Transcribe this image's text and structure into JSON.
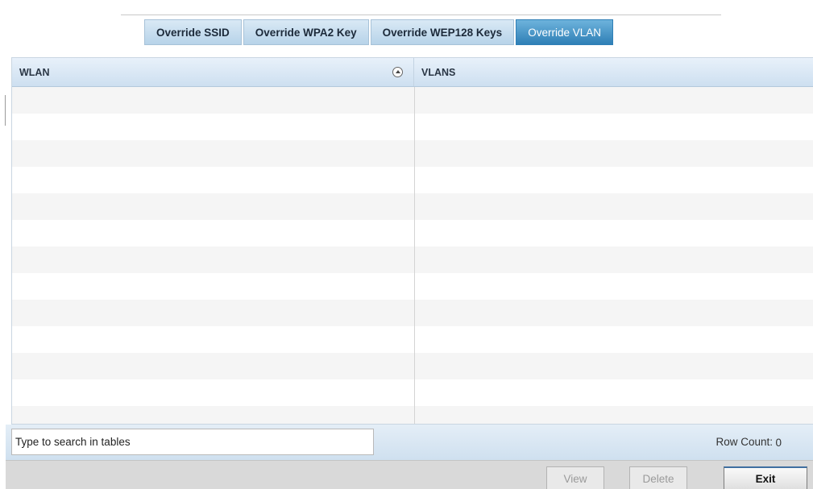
{
  "tabs": [
    {
      "label": "Override SSID"
    },
    {
      "label": "Override WPA2 Key"
    },
    {
      "label": "Override WEP128 Keys"
    },
    {
      "label": "Override VLAN",
      "active": true
    }
  ],
  "table": {
    "columns": [
      {
        "label": "WLAN",
        "sort_icon": "sort-ascending-icon"
      },
      {
        "label": "VLANS"
      }
    ],
    "rows": []
  },
  "search": {
    "placeholder": "Type to search in tables"
  },
  "row_count": {
    "label": "Row Count:",
    "value": "0"
  },
  "buttons": {
    "view": "View",
    "delete": "Delete",
    "exit": "Exit"
  },
  "colors": {
    "active_tab": "#2f7fb6",
    "tab": "#c7ddef",
    "header": "#d9e8f5",
    "footer": "#d9d9d9"
  }
}
